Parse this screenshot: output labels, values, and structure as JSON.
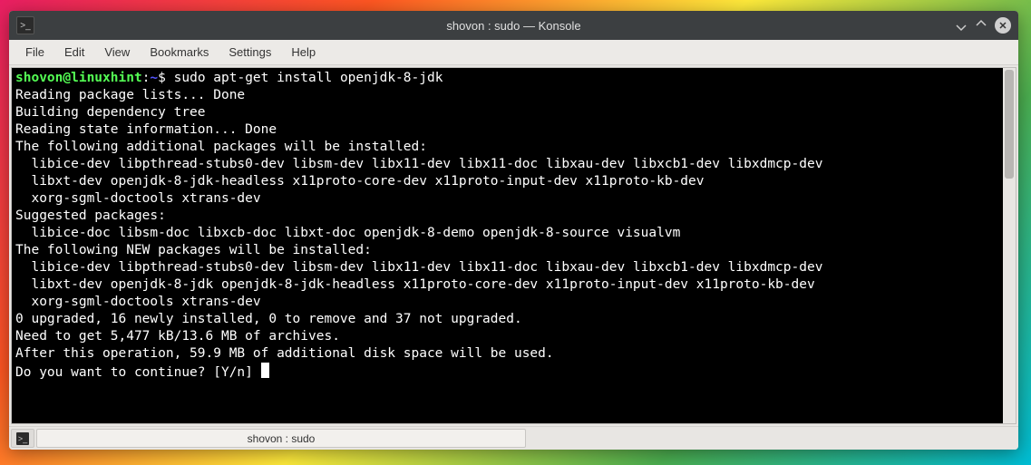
{
  "window": {
    "title": "shovon : sudo — Konsole"
  },
  "menubar": {
    "items": [
      "File",
      "Edit",
      "View",
      "Bookmarks",
      "Settings",
      "Help"
    ]
  },
  "prompt": {
    "user_host": "shovon@linuxhint",
    "separator": ":",
    "path": "~",
    "symbol": "$",
    "command": "sudo apt-get install openjdk-8-jdk"
  },
  "output_lines": [
    "Reading package lists... Done",
    "Building dependency tree",
    "Reading state information... Done",
    "The following additional packages will be installed:",
    "  libice-dev libpthread-stubs0-dev libsm-dev libx11-dev libx11-doc libxau-dev libxcb1-dev libxdmcp-dev",
    "  libxt-dev openjdk-8-jdk-headless x11proto-core-dev x11proto-input-dev x11proto-kb-dev",
    "  xorg-sgml-doctools xtrans-dev",
    "Suggested packages:",
    "  libice-doc libsm-doc libxcb-doc libxt-doc openjdk-8-demo openjdk-8-source visualvm",
    "The following NEW packages will be installed:",
    "  libice-dev libpthread-stubs0-dev libsm-dev libx11-dev libx11-doc libxau-dev libxcb1-dev libxdmcp-dev",
    "  libxt-dev openjdk-8-jdk openjdk-8-jdk-headless x11proto-core-dev x11proto-input-dev x11proto-kb-dev",
    "  xorg-sgml-doctools xtrans-dev",
    "0 upgraded, 16 newly installed, 0 to remove and 37 not upgraded.",
    "Need to get 5,477 kB/13.6 MB of archives.",
    "After this operation, 59.9 MB of additional disk space will be used.",
    "Do you want to continue? [Y/n] "
  ],
  "tab": {
    "label": "shovon : sudo"
  }
}
